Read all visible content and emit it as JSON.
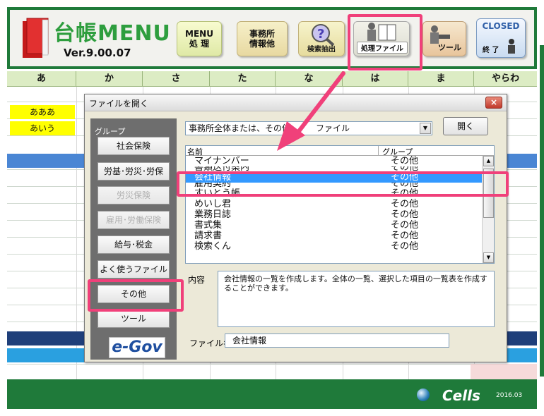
{
  "header": {
    "logo_title": "台帳MENU",
    "version": "Ver.9.00.07",
    "buttons": {
      "menu_line1": "MENU",
      "menu_line2": "処 理",
      "office_line1": "事務所",
      "office_line2": "情報他",
      "search": "検索抽出",
      "files": "処理ファイル",
      "tools": "ツール",
      "closed_top": "CLOSED",
      "closed_bottom": "終 了"
    }
  },
  "kana_columns": [
    "あ",
    "か",
    "さ",
    "た",
    "な",
    "は",
    "ま",
    "やらわ"
  ],
  "sheet_names": [
    "あああ",
    "あいう"
  ],
  "dialog": {
    "title": "ファイルを開く",
    "close": "×",
    "group_label": "グループ",
    "groups": [
      {
        "label": "社会保険",
        "enabled": true
      },
      {
        "label": "労基･労災･労保",
        "enabled": true
      },
      {
        "label": "労災保険",
        "enabled": false
      },
      {
        "label": "雇用･労働保険",
        "enabled": false
      },
      {
        "label": "給与･税金",
        "enabled": true
      },
      {
        "label": "よく使うファイル",
        "enabled": true
      },
      {
        "label": "その他",
        "enabled": true
      },
      {
        "label": "ツール",
        "enabled": true
      }
    ],
    "egov_label": "e-Gov",
    "filter_value": "事務所全体または、その他　　　ファイル",
    "open_button": "開く",
    "list_header": {
      "name": "名前",
      "group": "グループ"
    },
    "files": [
      {
        "name": "マイナンバー",
        "group": "その他"
      },
      {
        "name": "書類送付案内",
        "group": "その他"
      },
      {
        "name": "会社情報",
        "group": "その他",
        "selected": true
      },
      {
        "name": "雇用契約",
        "group": "その他"
      },
      {
        "name": "すいとう帳",
        "group": "その他"
      },
      {
        "name": "めいし君",
        "group": "その他"
      },
      {
        "name": "業務日誌",
        "group": "その他"
      },
      {
        "name": "書式集",
        "group": "その他"
      },
      {
        "name": "請求書",
        "group": "その他"
      },
      {
        "name": "検索くん",
        "group": "その他"
      }
    ],
    "content_label": "内容",
    "content_text": "会社情報の一覧を作成します。全体の一覧、選択した項目の一覧表を作成することができます。",
    "filename_label": "ファイル名",
    "filename_value": "会社情報"
  },
  "footer": {
    "brand": "Cells",
    "date": "2016.03"
  },
  "colors": {
    "frame_green": "#1f7a3a",
    "highlight_pink": "#f0407a",
    "selection_blue": "#3399ff"
  }
}
